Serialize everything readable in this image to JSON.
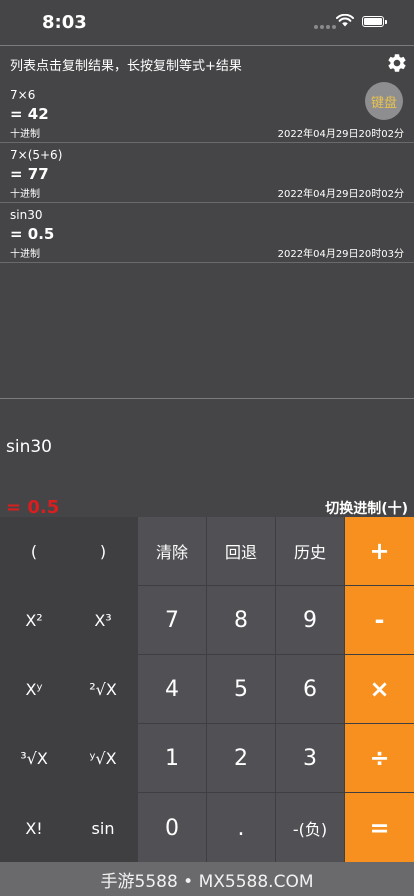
{
  "status": {
    "time": "8:03"
  },
  "hint": "列表点击复制结果，长按复制等式+结果",
  "icons": {
    "settings": "gear-icon",
    "wifi": "wifi-icon",
    "battery": "battery-icon"
  },
  "history": [
    {
      "expr": "7×6",
      "result": "= 42",
      "base": "十进制",
      "time": "2022年04月29日20时02分"
    },
    {
      "expr": "7×(5+6)",
      "result": "= 77",
      "base": "十进制",
      "time": "2022年04月29日20时02分"
    },
    {
      "expr": "sin30",
      "result": "= 0.5",
      "base": "十进制",
      "time": "2022年04月29日20时03分"
    }
  ],
  "keyboard_button": "键盘",
  "input": {
    "expression": "sin30",
    "result": "= 0.5",
    "base_switch": "切换进制(十)"
  },
  "keys": {
    "r1": [
      "(",
      ")",
      "清除",
      "回退",
      "历史",
      "+"
    ],
    "r2": [
      "X²",
      "X³",
      "7",
      "8",
      "9",
      "-"
    ],
    "r3": [
      "Xʸ",
      "²√X",
      "4",
      "5",
      "6",
      "×"
    ],
    "r4": [
      "³√X",
      "ʸ√X",
      "1",
      "2",
      "3",
      "÷"
    ],
    "r5": [
      "X!",
      "sin",
      "0",
      ".",
      "-(负)",
      "="
    ]
  },
  "watermark": "手游5588 • MX5588.COM",
  "colors": {
    "accent": "#f7901e",
    "result_red": "#d81e1e",
    "keyboard_gold": "#e8c24e"
  }
}
